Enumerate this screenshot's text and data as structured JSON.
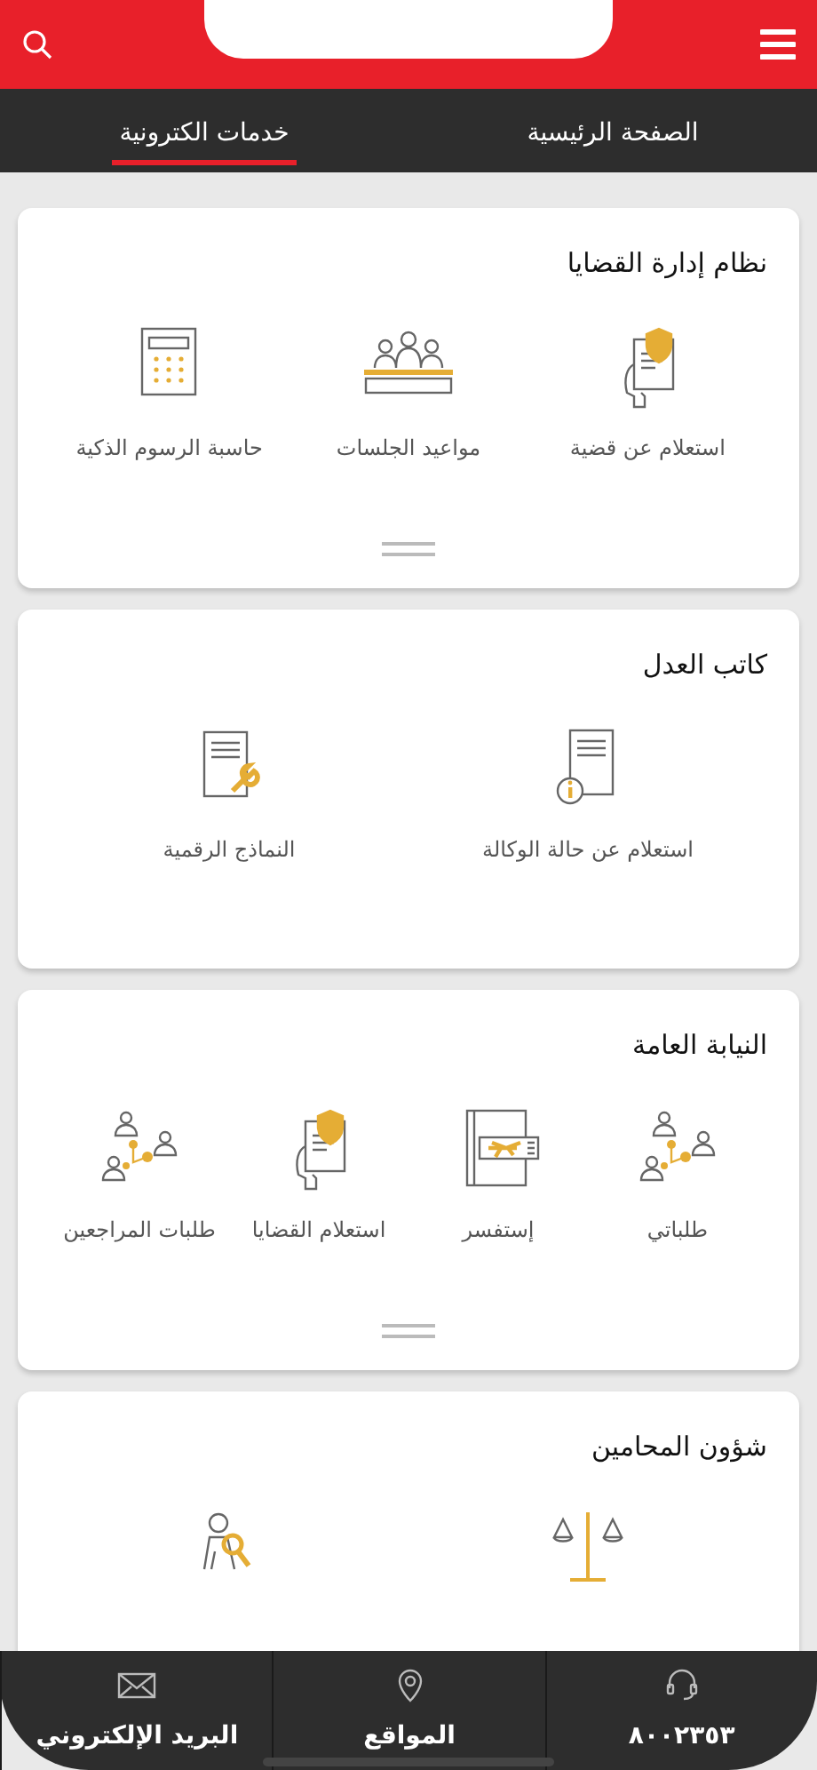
{
  "tabs": [
    {
      "label": "الصفحة الرئيسية",
      "selected": false
    },
    {
      "label": "خدمات الكترونية",
      "selected": true
    }
  ],
  "sections": [
    {
      "title": "نظام إدارة القضايا",
      "more_handle": true,
      "items": [
        {
          "kind": "shield-doc",
          "label": "استعلام عن قضية"
        },
        {
          "kind": "panel",
          "label": "مواعيد الجلسات"
        },
        {
          "kind": "calculator",
          "label": "حاسبة الرسوم الذكية"
        }
      ]
    },
    {
      "title": "كاتب العدل",
      "more_handle": false,
      "items": [
        {
          "kind": "info-doc",
          "label": "استعلام عن حالة الوكالة"
        },
        {
          "kind": "wrench-doc",
          "label": "النماذج الرقمية"
        }
      ]
    },
    {
      "title": "النيابة العامة",
      "more_handle": true,
      "items": [
        {
          "kind": "network",
          "label": "طلباتي"
        },
        {
          "kind": "passport",
          "label": "إستفسر"
        },
        {
          "kind": "shield-doc",
          "label": "استعلام القضايا"
        },
        {
          "kind": "network",
          "label": "طلبات المراجعين"
        }
      ]
    },
    {
      "title": "شؤون المحامين",
      "more_handle": false,
      "items": [
        {
          "kind": "scales"
        },
        {
          "kind": "person-search"
        }
      ]
    }
  ],
  "bottom_nav": [
    {
      "kind": "headset",
      "label": "٨٠٠٢٣٥٣"
    },
    {
      "kind": "pin",
      "label": "المواقع"
    },
    {
      "kind": "mail",
      "label": "البريد الإلكتروني"
    }
  ]
}
